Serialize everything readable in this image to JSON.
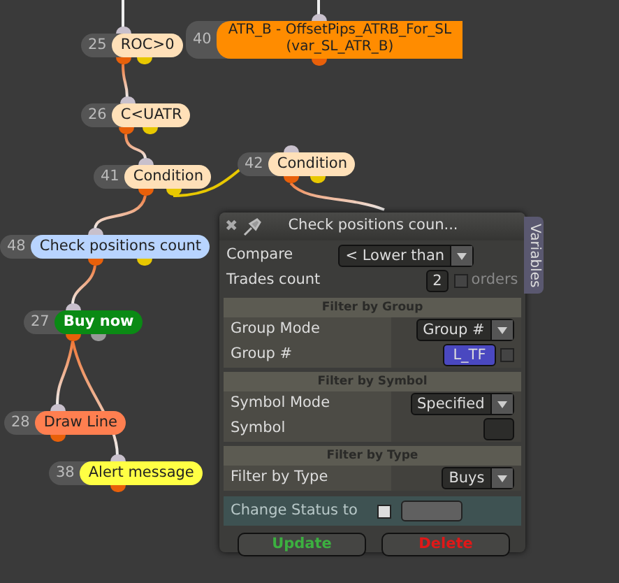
{
  "nodes": [
    {
      "number": "25",
      "label": "ROC>0",
      "color": "#ffe0b8"
    },
    {
      "number": "40",
      "label": "ATR_B - OffsetPips_ATRB_For_SL",
      "sublabel": "(var_SL_ATR_B)",
      "color": "#ff8c00"
    },
    {
      "number": "26",
      "label": "C<UATR",
      "color": "#ffe0b8"
    },
    {
      "number": "41",
      "label": "Condition",
      "color": "#ffe0b8"
    },
    {
      "number": "42",
      "label": "Condition",
      "color": "#ffe0b8"
    },
    {
      "number": "48",
      "label": "Check positions count",
      "color": "#b8d4ff"
    },
    {
      "number": "27",
      "label": "Buy now",
      "color": "#0a8a14"
    },
    {
      "number": "28",
      "label": "Draw Line",
      "color": "#ff7f50"
    },
    {
      "number": "38",
      "label": "Alert message",
      "color": "#ffff44"
    }
  ],
  "panel": {
    "close": "✖",
    "title": "Check positions coun...",
    "side_tab": "Variables",
    "fields": [
      {
        "label": "Compare",
        "kind": "dropdown",
        "value": "< Lower than"
      },
      {
        "label": "Trades count",
        "kind": "number",
        "value": "2",
        "unit": "orders",
        "checked": false
      }
    ],
    "sections": [
      {
        "title": "Filter by Group",
        "fields": [
          {
            "label": "Group Mode",
            "kind": "dropdown",
            "value": "Group #"
          },
          {
            "label": "Group #",
            "kind": "tag",
            "value": "L_TF",
            "checked": false
          }
        ]
      },
      {
        "title": "Filter by Symbol",
        "fields": [
          {
            "label": "Symbol Mode",
            "kind": "dropdown",
            "value": "Specified"
          },
          {
            "label": "Symbol",
            "kind": "empty"
          }
        ]
      },
      {
        "title": "Filter by Type",
        "fields": [
          {
            "label": "Filter by Type",
            "kind": "dropdown",
            "value": "Buys"
          }
        ]
      }
    ],
    "status": {
      "label": "Change Status to",
      "checked": false
    },
    "buttons": [
      {
        "label": "Update",
        "kind": "update"
      },
      {
        "label": "Delete",
        "kind": "delete"
      }
    ]
  }
}
